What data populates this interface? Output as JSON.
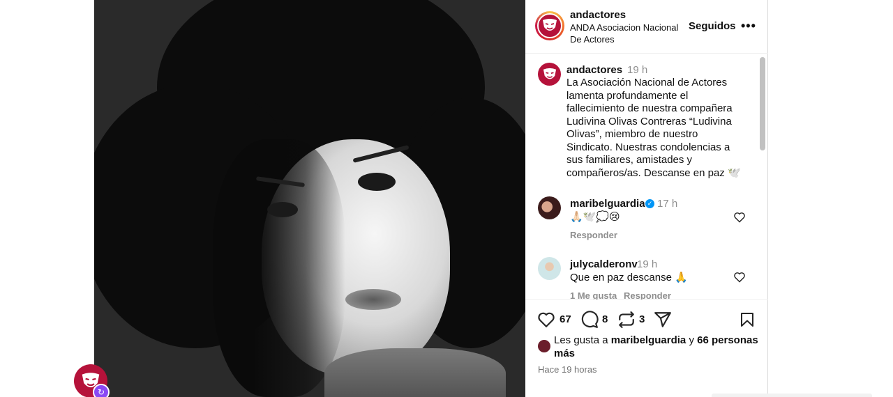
{
  "post": {
    "author_username": "andactores",
    "author_fullname": "ANDA Asociacion Nacional De Actores",
    "follow_state": "Seguidos",
    "more_label": "•••",
    "caption": {
      "username": "andactores",
      "time": "19 h",
      "text": "La Asociación Nacional de Actores lamenta profundamente el fallecimiento de nuestra compañera Ludivina Olivas Contreras “Ludivina Olivas”, miembro de nuestro Sindicato. Nuestras condolencias a sus familiares, amistades y compañeros/as. Descanse en paz 🕊️"
    },
    "comments": [
      {
        "username": "maribelguardia",
        "verified": true,
        "time": "17 h",
        "text": "🙏🏻🕊️💭😢",
        "reply_label": "Responder",
        "likes_label": ""
      },
      {
        "username": "julycalderonv",
        "verified": false,
        "time": "19 h",
        "text": "Que en paz descanse 🙏",
        "likes_label": "1 Me gusta",
        "reply_label": "Responder"
      }
    ],
    "actions": {
      "likes_count": "67",
      "comments_count": "8",
      "reposts_count": "3"
    },
    "liked_by": {
      "prefix": "Les gusta a ",
      "user": "maribelguardia",
      "joiner": " y ",
      "others": "66 personas más"
    },
    "posted_ago": "Hace 19 horas"
  },
  "colors": {
    "brand": "#b5123a",
    "verified": "#0095f6",
    "muted": "#8e8e8e",
    "badge": "#8a49f4"
  },
  "icons": {
    "like": "heart-icon",
    "comment": "comment-icon",
    "repost": "repost-icon",
    "share": "share-icon",
    "save": "bookmark-icon",
    "more": "more-icon",
    "verified": "verified-icon"
  }
}
